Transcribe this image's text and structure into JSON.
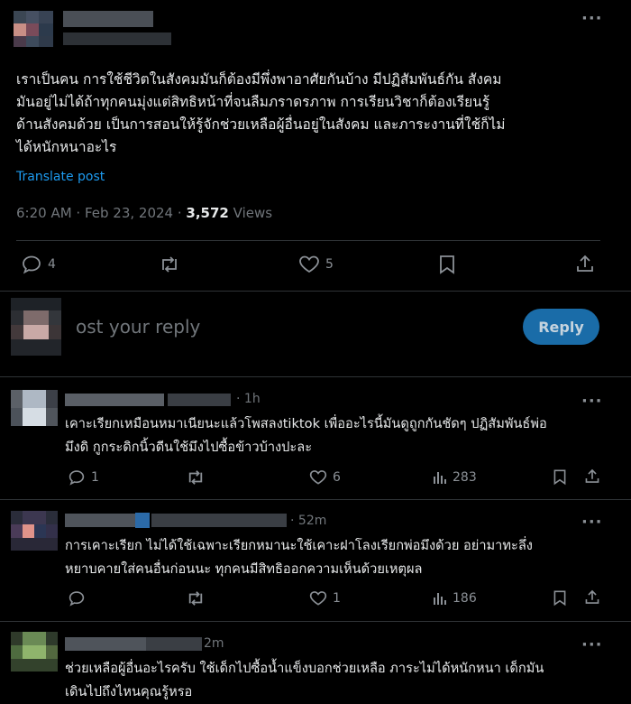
{
  "post": {
    "text_lines": [
      "เราเป็นคน การใช้ชีวิตในสังคมมันก็ต้องมีพึ่งพาอาศัยกันบ้าง มีปฏิสัมพันธ์กัน สังคม",
      "มันอยู่ไม่ได้ถ้าทุกคนมุ่งแต่สิทธิหน้าที่จนลืมภราดรภาพ การเรียนวิชาก็ต้องเรียนรู้",
      "ด้านสังคมด้วย เป็นการสอนให้รู้จักช่วยเหลือผู้อื่นอยู่ในสังคม และภาระงานที่ใช้ก็ไม่",
      "ได้หนักหนาอะไร"
    ],
    "translate_label": "Translate post",
    "time": "6:20 AM",
    "date": "Feb 23, 2024",
    "views_count": "3,572",
    "views_label": "Views",
    "replies": "4",
    "likes": "5"
  },
  "composer": {
    "placeholder": "Post your reply",
    "visible_placeholder": "ost your reply",
    "button_label": "Reply"
  },
  "replies": [
    {
      "time": "1h",
      "lines": [
        "เคาะเรียกเหมือนหมาเนียนะแล้วโพสลงtiktok เพื่ออะไรนี้มันดูถูกกันชัดๆ ปฏิสัมพันธ์พ่อ",
        "มึงดิ กูกระดิกนิ้วดีนใช้มึงไปซื้อข้าวบ้างปะละ"
      ],
      "reply_count": "1",
      "repost_count": "",
      "like_count": "6",
      "view_count": "283"
    },
    {
      "time": "52m",
      "lines": [
        "การเคาะเรียก ไม่ได้ใช้เฉพาะเรียกหมานะใช้เคาะฝาโลงเรียกพ่อมึงด้วย อย่ามาทะลึ่ง",
        "หยาบคายใส่คนอื่นก่อนนะ ทุกคนมีสิทธิออกความเห็นด้วยเหตุผล"
      ],
      "reply_count": "",
      "repost_count": "",
      "like_count": "1",
      "view_count": "186"
    },
    {
      "time": "2m",
      "lines": [
        "ช่วยเหลือผู้อื่นอะไรครับ ใช้เด็กไปซื้อน้ำแข็งบอกช่วยเหลือ ภาระไม่ได้หนักหนา เด็กมัน",
        "เดินไปถึงไหนคุณรู้หรอ"
      ]
    }
  ],
  "icons": {
    "more": "more-horizontal-icon",
    "reply": "reply-bubble-icon",
    "repost": "repost-icon",
    "like": "heart-icon",
    "bookmark": "bookmark-icon",
    "share": "share-icon",
    "views": "analytics-bars-icon"
  },
  "colors": {
    "background": "#000000",
    "text": "#e7e9ea",
    "muted": "#71767b",
    "link": "#1d9bf0",
    "reply_button": "#1a6ca8",
    "divider": "#2f3336"
  }
}
